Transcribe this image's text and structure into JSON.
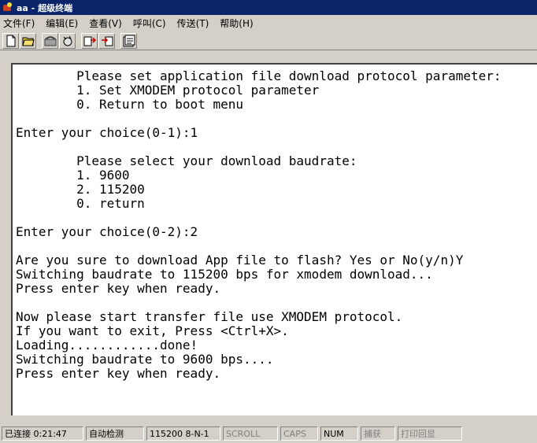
{
  "window": {
    "title": "aa - 超级终端"
  },
  "menu": [
    "文件(F)",
    "编辑(E)",
    "查看(V)",
    "呼叫(C)",
    "传送(T)",
    "帮助(H)"
  ],
  "toolbar": {
    "icons": [
      "new-file-icon",
      "open-folder-icon",
      "dial-icon",
      "hang-up-icon",
      "send-icon",
      "receive-icon",
      "properties-icon"
    ]
  },
  "terminal": {
    "lines": [
      "        Please set application file download protocol parameter:",
      "        1. Set XMODEM protocol parameter",
      "        0. Return to boot menu",
      "",
      "Enter your choice(0-1):1",
      "",
      "        Please select your download baudrate:",
      "        1. 9600",
      "        2. 115200",
      "        0. return",
      "",
      "Enter your choice(0-2):2",
      "",
      "Are you sure to download App file to flash? Yes or No(y/n)Y",
      "Switching baudrate to 115200 bps for xmodem download...",
      "Press enter key when ready.",
      "",
      "Now please start transfer file use XMODEM protocol.",
      "If you want to exit, Press <Ctrl+X>.",
      "Loading............done!",
      "Switching baudrate to 9600 bps....",
      "Press enter key when ready."
    ]
  },
  "status": {
    "connected": "已连接 0:21:47",
    "detect": "自动检测",
    "params": "115200 8-N-1",
    "scroll": "SCROLL",
    "caps": "CAPS",
    "num": "NUM",
    "capture": "捕获",
    "print_echo": "打印回显"
  }
}
